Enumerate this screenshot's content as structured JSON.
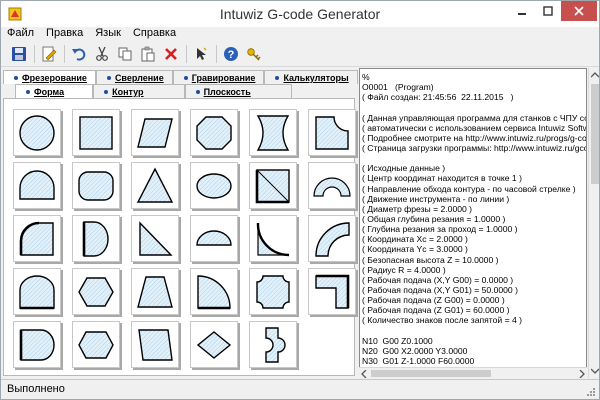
{
  "window": {
    "title": "Intuwiz G-code Generator"
  },
  "menu": {
    "items": [
      "Файл",
      "Правка",
      "Язык",
      "Справка"
    ]
  },
  "toolbar": {
    "buttons": [
      "save-icon",
      "edit-icon",
      "undo-icon",
      "cut-icon",
      "copy-icon",
      "paste-icon",
      "delete-icon",
      "pointer-icon",
      "help-icon",
      "key-icon"
    ]
  },
  "tabs": {
    "row1": [
      "Фрезерование",
      "Сверление",
      "Гравирование",
      "Калькуляторы"
    ],
    "row2": [
      "Форма",
      "Контур",
      "Плоскость"
    ]
  },
  "shapes": {
    "items": [
      "circle",
      "square",
      "parallelogram",
      "octagon",
      "concave-rectangle",
      "rounded-corner-square",
      "half-round-rectangle",
      "rounded-rectangle",
      "triangle",
      "ellipse",
      "square-with-diagonal",
      "half-ring",
      "quarter-round-square",
      "d-shape",
      "right-triangle",
      "half-ellipse",
      "concave-quarter",
      "quarter-ring",
      "arch-rectangle",
      "hexagon-wide",
      "trapezoid",
      "quarter-circle",
      "rectangle-with-notches",
      "l-shape",
      "half-round-square",
      "wide-hexagon",
      "slanted-trapezoid",
      "diamond",
      "bracket-shape"
    ]
  },
  "editor": {
    "lines": [
      "%",
      "O0001   (Program)",
      "( Файл создан: 21:45:56  22.11.2015   )",
      "",
      "( Данная управляющая программа для станков с ЧПУ созд",
      "( автоматически с использованием сервиса Intuwiz Softwa",
      "( Подробнее смотрите на http://www.intuwiz.ru/progs/g-co",
      "( Страница загрузки программы: http://www.intuwiz.ru/gco",
      "",
      "( Исходные данные )",
      "( Центр координат находится в точке 1 )",
      "( Направление обхода контура - по часовой стрелке )",
      "( Движение инструмента - по линии )",
      "( Диаметр фрезы = 2.0000 )",
      "( Общая глубина резания = 1.0000 )",
      "( Глубина резания за проход = 1.0000 )",
      "( Координата Xc = 2.0000 )",
      "( Координата Yc = 3.0000 )",
      "( Безопасная высота Z = 10.0000 )",
      "( Радиус R = 4.0000 )",
      "( Рабочая подача (X,Y G00) = 0.0000 )",
      "( Рабочая подача (X,Y G01) = 50.0000 )",
      "( Рабочая подача (Z G00) = 0.0000 )",
      "( Рабочая подача (Z G01) = 60.0000 )",
      "( Количество знаков после запятой = 4 )",
      "",
      "N10  G00 Z0.1000",
      "N20  G00 X2.0000 Y3.0000",
      "N30  G01 Z-1.0000 F60.0000"
    ]
  },
  "status": {
    "text": "Выполнено"
  },
  "colors": {
    "accent": "#1f4e9a",
    "shape_fill": "#dbeef8",
    "close_button": "#c7504f"
  }
}
